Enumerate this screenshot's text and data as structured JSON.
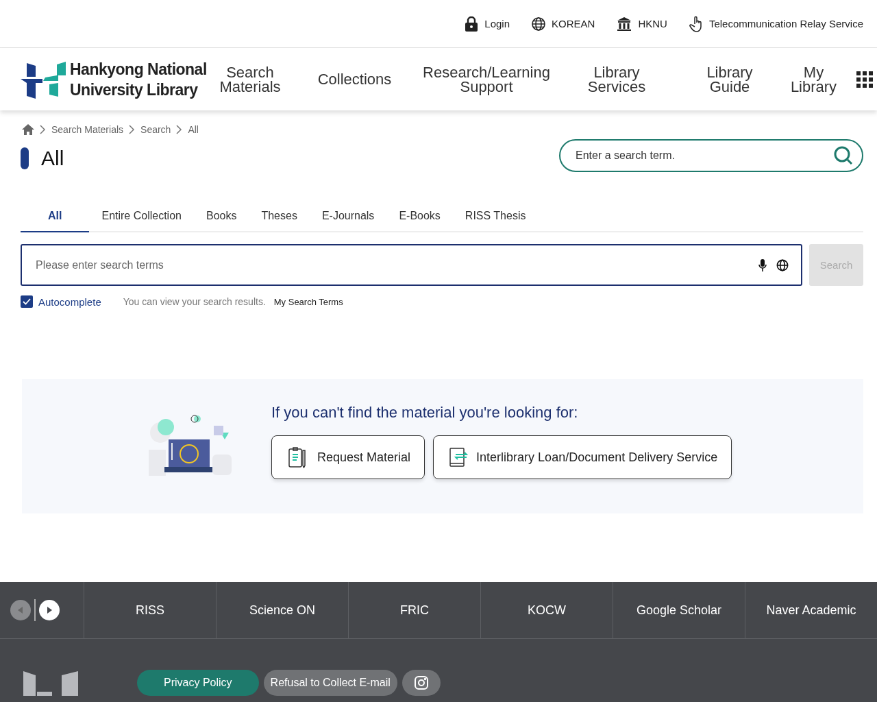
{
  "utility_bar": {
    "items": [
      {
        "kind": "lock",
        "label": "Login"
      },
      {
        "kind": "globe",
        "label": "KOREAN"
      },
      {
        "kind": "building",
        "label": "HKNU"
      },
      {
        "kind": "hand",
        "label": "Telecommunication Relay Service"
      }
    ]
  },
  "header": {
    "logo_lines": [
      "Hankyong National",
      "University Library"
    ],
    "nav": [
      {
        "lines": [
          "Search",
          "Materials"
        ]
      },
      {
        "lines": [
          "Collections"
        ]
      },
      {
        "lines": [
          "Research/Learning",
          "Support"
        ]
      },
      {
        "lines": [
          "Library",
          "Services"
        ]
      },
      {
        "lines": [
          "Library",
          "Guide"
        ]
      },
      {
        "lines": [
          "My",
          "Library"
        ]
      }
    ]
  },
  "breadcrumb": [
    "Search Materials",
    "Search",
    "All"
  ],
  "page_title": "All",
  "quick_search": {
    "placeholder": "Enter a search term."
  },
  "tabs": [
    {
      "label": "All",
      "selected": true
    },
    {
      "label": "Entire Collection",
      "selected": false
    },
    {
      "label": "Books",
      "selected": false
    },
    {
      "label": "Theses",
      "selected": false
    },
    {
      "label": "E-Journals",
      "selected": false
    },
    {
      "label": "E-Books",
      "selected": false
    },
    {
      "label": "RISS Thesis",
      "selected": false
    }
  ],
  "search": {
    "placeholder": "Please enter search terms",
    "button": "Search",
    "button_disabled": true
  },
  "options": {
    "autocomplete": {
      "label": "Autocomplete",
      "checked": true
    },
    "hint": "You can view your search results.",
    "my_terms": "My Search Terms"
  },
  "notice": {
    "heading": "If you can't find the material you're looking for:",
    "buttons": [
      {
        "kind": "request",
        "label": "Request Material"
      },
      {
        "kind": "loan",
        "label": "Interlibrary Loan/Document Delivery Service"
      }
    ]
  },
  "footer": {
    "sites": [
      "RISS",
      "Science ON",
      "FRIC",
      "KOCW",
      "Google Scholar",
      "Naver Academic"
    ],
    "policy_links": [
      {
        "label": "Privacy Policy",
        "highlighted": true
      },
      {
        "label": "Refusal to Collect E-mail",
        "highlighted": false
      }
    ]
  }
}
